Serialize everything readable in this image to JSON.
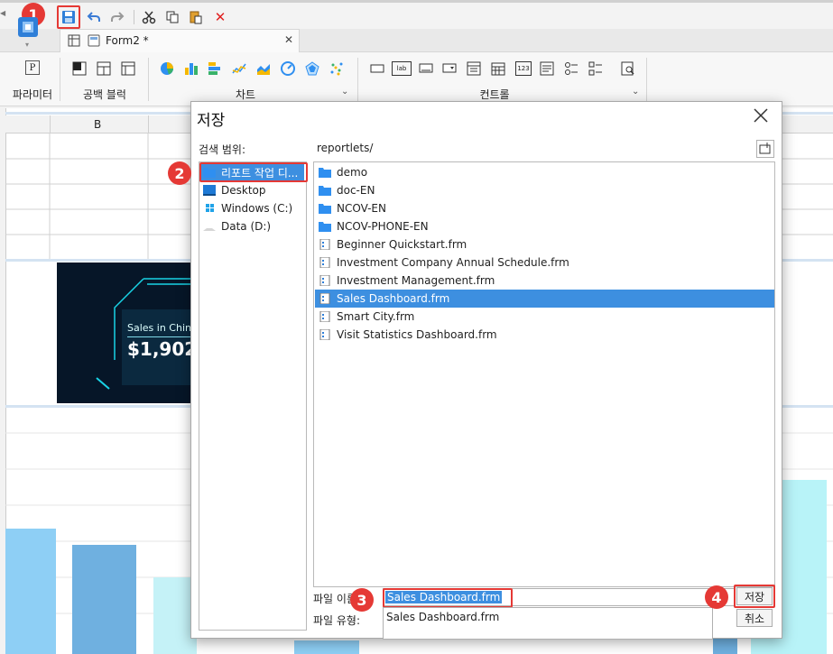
{
  "toolbar": {
    "badge_1": "1",
    "icons": [
      "save-icon",
      "undo-icon",
      "redo-icon",
      "cut-icon",
      "copy-icon",
      "paste-icon",
      "delete-icon"
    ]
  },
  "tabs": {
    "doc_tab_label": "Form2 *",
    "close_glyph": "✕"
  },
  "ribbon": {
    "param_label": "파라미터",
    "blank_block_label": "공백 블럭",
    "chart_label": "차트",
    "control_label": "컨트롤",
    "icon_p": "P",
    "icon_lab": "lab",
    "icon_123": "123"
  },
  "grid": {
    "col_b": "B"
  },
  "background_card": {
    "sales_title": "Sales in Chin",
    "sales_value": "$1,902"
  },
  "dialog": {
    "title": "저장",
    "search_scope_label": "검색 범위:",
    "current_path": "reportlets/",
    "locations": [
      {
        "label": "리포트 작업 디...",
        "icon": "folder-icon",
        "selected": true
      },
      {
        "label": "Desktop",
        "icon": "desktop-icon",
        "selected": false
      },
      {
        "label": "Windows (C:)",
        "icon": "windows-drive-icon",
        "selected": false
      },
      {
        "label": "Data (D:)",
        "icon": "drive-icon",
        "selected": false
      }
    ],
    "files": [
      {
        "name": "demo",
        "type": "folder"
      },
      {
        "name": "doc-EN",
        "type": "folder"
      },
      {
        "name": "NCOV-EN",
        "type": "folder"
      },
      {
        "name": "NCOV-PHONE-EN",
        "type": "folder"
      },
      {
        "name": "Beginner Quickstart.frm",
        "type": "file"
      },
      {
        "name": "Investment Company Annual Schedule.frm",
        "type": "file"
      },
      {
        "name": "Investment Management.frm",
        "type": "file"
      },
      {
        "name": "Sales Dashboard.frm",
        "type": "file",
        "selected": true
      },
      {
        "name": "Smart City.frm",
        "type": "file"
      },
      {
        "name": "Visit Statistics Dashboard.frm",
        "type": "file"
      }
    ],
    "filename_label": "파일 이름:",
    "filetype_label": "파일 유형:",
    "filename_value": "Sales Dashboard.frm",
    "filetype_option": "Sales Dashboard.frm",
    "save_button": "저장",
    "cancel_button": "취소",
    "badge_2": "2",
    "badge_3": "3",
    "badge_4": "4"
  },
  "colors": {
    "highlight_red": "#e53935",
    "selection_blue": "#3d8fe0",
    "folder_blue": "#2f8ff0"
  }
}
